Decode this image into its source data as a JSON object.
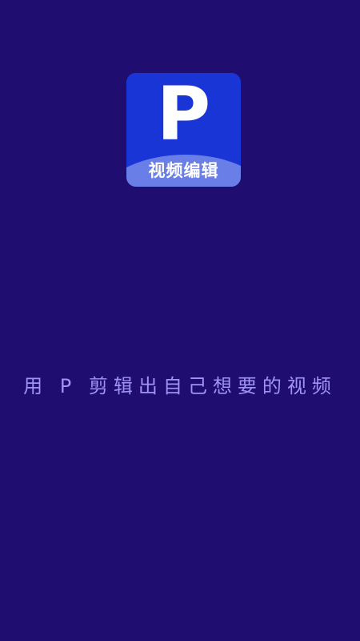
{
  "splash": {
    "app_icon": {
      "letter": "P",
      "label": "视频编辑"
    },
    "slogan": "用 P 剪辑出自己想要的视频"
  },
  "colors": {
    "background": "#1f0e70",
    "icon_primary": "#1a35d6",
    "icon_wave": "#6a7ee8",
    "slogan_text": "#9f93f3"
  }
}
